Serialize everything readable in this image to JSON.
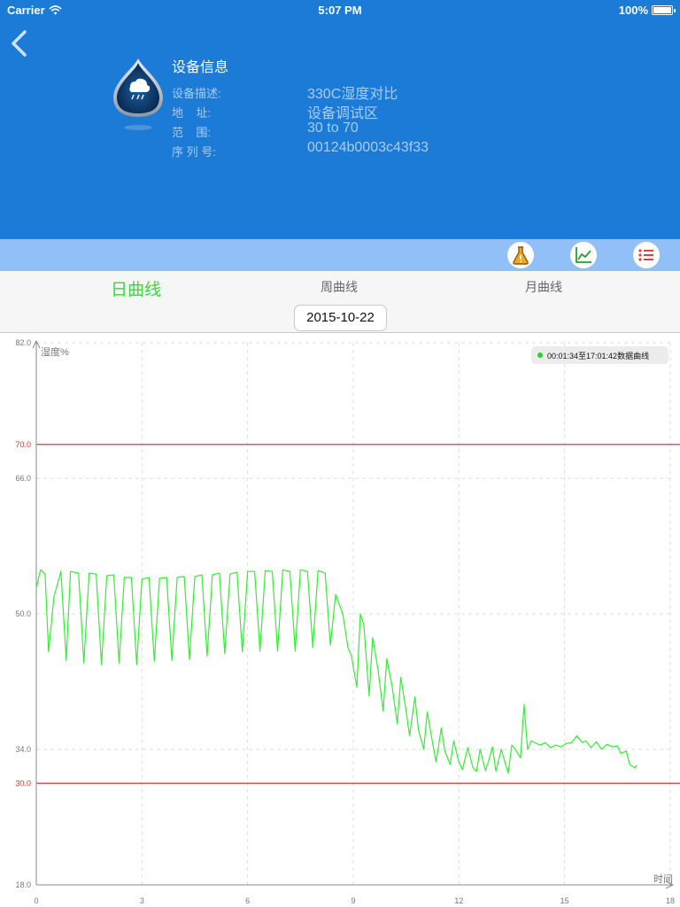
{
  "status_bar": {
    "carrier": "Carrier",
    "time": "5:07 PM",
    "battery": "100%"
  },
  "device": {
    "title": "设备信息",
    "rows": [
      {
        "label": "设备描述:",
        "value": "330C湿度对比"
      },
      {
        "label": "地    址:",
        "value": "设备调试区"
      },
      {
        "label": "范    围:",
        "value": "30 to 70"
      },
      {
        "label": "序 列 号:",
        "value": "00124b0003c43f33"
      }
    ]
  },
  "toolbar": {
    "icons": [
      "flask-warning-icon",
      "line-chart-icon",
      "list-icon"
    ]
  },
  "tabs": [
    {
      "label": "日曲线",
      "active": true
    },
    {
      "label": "周曲线",
      "active": false
    },
    {
      "label": "月曲线",
      "active": false
    }
  ],
  "date": "2015-10-22",
  "colors": {
    "header": "#1b7bd6",
    "toolbar": "#90c0f7",
    "series": "#33ee33",
    "limit": "#ee3333",
    "active_tab": "#33dd33"
  },
  "chart_data": {
    "type": "line",
    "ylabel": "湿度%",
    "xlabel": "时间",
    "xlim": [
      0,
      18
    ],
    "ylim": [
      18,
      82
    ],
    "x_ticks": [
      "0",
      "3",
      "6",
      "9",
      "12",
      "15",
      "18"
    ],
    "y_ticks": [
      "82.0",
      "70.0",
      "66.0",
      "50.0",
      "34.0",
      "30.0",
      "18.0"
    ],
    "limit_lines": [
      70,
      30
    ],
    "grid": true,
    "legend": {
      "label": "00:01:34至17:01:42数据曲线",
      "placement": "top-right"
    },
    "series": [
      {
        "x": [
          0.0,
          0.12,
          0.25,
          0.35,
          0.5,
          0.7,
          0.85,
          0.97,
          1.2,
          1.35,
          1.5,
          1.7,
          1.85,
          2.0,
          2.2,
          2.35,
          2.5,
          2.7,
          2.85,
          3.0,
          3.2,
          3.35,
          3.5,
          3.7,
          3.85,
          4.0,
          4.2,
          4.35,
          4.5,
          4.7,
          4.85,
          5.0,
          5.2,
          5.35,
          5.5,
          5.7,
          5.85,
          6.0,
          6.2,
          6.35,
          6.5,
          6.7,
          6.85,
          7.0,
          7.2,
          7.35,
          7.5,
          7.7,
          7.85,
          8.0,
          8.2,
          8.35,
          8.5,
          8.7,
          8.85,
          8.95,
          9.1,
          9.2,
          9.3,
          9.45,
          9.55,
          9.7,
          9.85,
          9.95,
          10.1,
          10.25,
          10.35,
          10.5,
          10.6,
          10.75,
          10.85,
          11.0,
          11.1,
          11.25,
          11.35,
          11.5,
          11.6,
          11.75,
          11.85,
          12.0,
          12.1,
          12.25,
          12.4,
          12.5,
          12.6,
          12.75,
          12.85,
          12.95,
          13.05,
          13.2,
          13.3,
          13.4,
          13.5,
          13.6,
          13.75,
          13.85,
          13.95,
          14.05,
          14.15,
          14.3,
          14.45,
          14.6,
          14.75,
          14.9,
          15.05,
          15.2,
          15.35,
          15.5,
          15.6,
          15.75,
          15.9,
          16.05,
          16.2,
          16.35,
          16.5,
          16.6,
          16.75,
          16.85,
          17.0,
          17.05
        ],
        "y": [
          53.0,
          55.2,
          54.7,
          45.5,
          52.0,
          55.0,
          44.5,
          55.0,
          54.8,
          44.2,
          54.8,
          54.7,
          44.0,
          54.5,
          54.6,
          44.2,
          54.3,
          54.3,
          44.0,
          54.1,
          54.3,
          44.4,
          54.2,
          54.3,
          44.5,
          54.3,
          54.4,
          44.6,
          54.4,
          54.6,
          45.0,
          54.6,
          54.8,
          45.3,
          54.7,
          54.9,
          45.5,
          55.0,
          55.0,
          45.6,
          55.1,
          55.0,
          45.6,
          55.2,
          55.0,
          45.6,
          55.2,
          55.0,
          46.0,
          55.1,
          54.8,
          46.3,
          52.3,
          50.0,
          46.0,
          45.0,
          41.3,
          50.0,
          48.7,
          40.3,
          47.2,
          43.5,
          38.5,
          44.7,
          41.5,
          37.0,
          42.5,
          38.5,
          35.6,
          40.2,
          36.3,
          34.0,
          38.4,
          34.8,
          32.5,
          36.5,
          33.8,
          32.2,
          35.0,
          32.5,
          31.6,
          34.2,
          31.8,
          31.4,
          34.0,
          31.5,
          32.7,
          34.3,
          31.4,
          34.0,
          32.6,
          31.2,
          34.5,
          34.0,
          33.0,
          39.3,
          34.0,
          35.0,
          34.8,
          34.5,
          34.8,
          34.2,
          34.5,
          34.3,
          34.7,
          34.8,
          35.6,
          34.8,
          35.0,
          34.2,
          34.9,
          34.0,
          34.6,
          34.3,
          34.4,
          33.5,
          33.8,
          32.2,
          31.8,
          32.1
        ]
      }
    ]
  }
}
